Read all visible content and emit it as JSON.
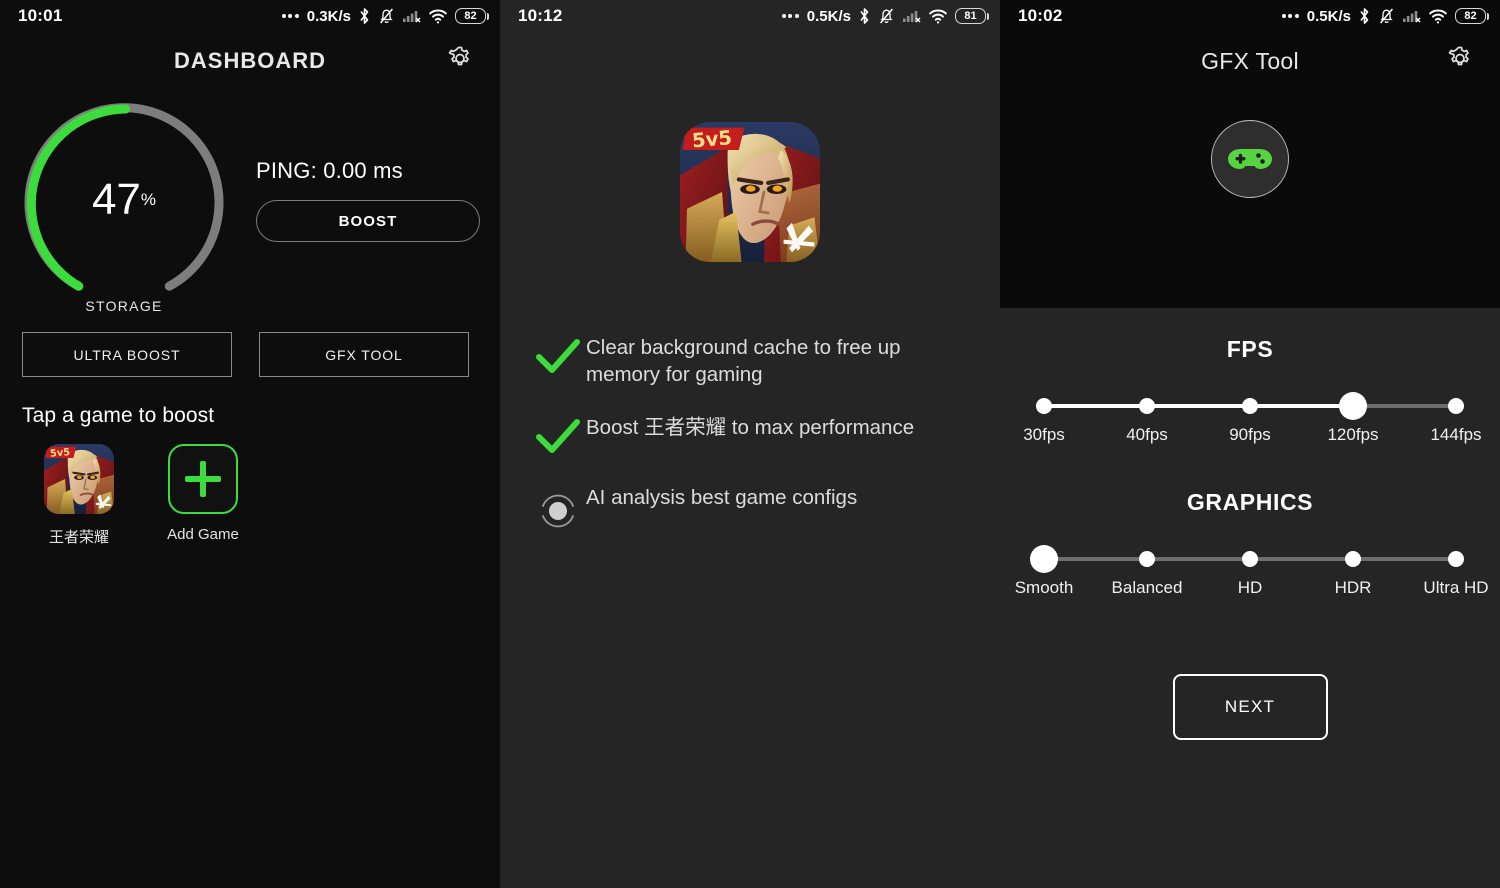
{
  "theme": {
    "accent_green": "#3ddc3d",
    "panel_dark": "#0d0d0d",
    "panel_light": "#252525",
    "gfx_top_bg": "#0a0a0a",
    "track_gray": "#6e6e6e",
    "text_primary": "#ffffff"
  },
  "dashboard": {
    "statusbar": {
      "time": "10:01",
      "speed": "0.3K/s",
      "battery": "82",
      "icons": [
        "bluetooth-icon",
        "mute-bell-icon",
        "signal-off-icon",
        "wifi-icon",
        "battery-icon"
      ]
    },
    "title": "DASHBOARD",
    "gear_icon": "gear-icon",
    "gauge": {
      "value": "47",
      "percent_symbol": "%",
      "label": "STORAGE",
      "fill_percent": 47,
      "fill_color": "#3ddc3d",
      "track_color": "#7d7d7d"
    },
    "ping_text": "PING: 0.00 ms",
    "boost_label": "BOOST",
    "ultra_boost_label": "ULTRA BOOST",
    "gfx_tool_label": "GFX TOOL",
    "tap_hint": "Tap a game to boost",
    "games": [
      {
        "name": "王者荣耀",
        "icon": "game-artwork-icon"
      },
      {
        "name": "Add Game",
        "icon": "plus-icon"
      }
    ]
  },
  "boost": {
    "statusbar": {
      "time": "10:12",
      "speed": "0.5K/s",
      "battery": "81"
    },
    "game_icon": "game-artwork-icon",
    "checklist": [
      {
        "state": "done",
        "text": "Clear background cache to free up memory for gaming"
      },
      {
        "state": "done",
        "text": "Boost 王者荣耀 to max performance"
      },
      {
        "state": "loading",
        "text": "AI analysis best game configs"
      }
    ]
  },
  "gfx": {
    "statusbar": {
      "time": "10:02",
      "speed": "0.5K/s",
      "battery": "82"
    },
    "title": "GFX Tool",
    "gear_icon": "gear-icon",
    "hero_icon": "gamepad-icon",
    "fps": {
      "title": "FPS",
      "options": [
        "30fps",
        "40fps",
        "90fps",
        "120fps",
        "144fps"
      ],
      "selected_index": 3
    },
    "graphics": {
      "title": "GRAPHICS",
      "options": [
        "Smooth",
        "Balanced",
        "HD",
        "HDR",
        "Ultra HD"
      ],
      "selected_index": 0
    },
    "next_label": "NEXT"
  }
}
